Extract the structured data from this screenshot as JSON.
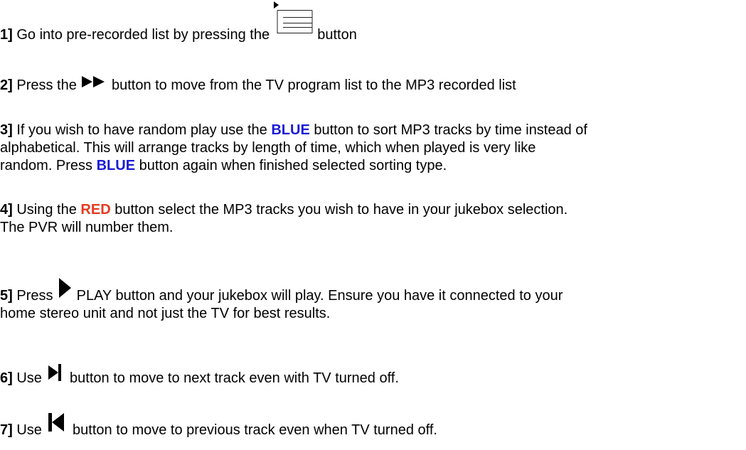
{
  "steps": [
    {
      "num": "1]",
      "before": " Go into pre-recorded list by pressing the ",
      "icon": "list-button-icon",
      "after": " button"
    },
    {
      "num": "2]",
      "before": " Press the ",
      "icon": "fast-forward-icon",
      "after": " button to move from the TV program list to the MP3 recorded list"
    },
    {
      "num": "3]",
      "before": " If you wish to have random play use the ",
      "blue1": "BLUE",
      "mid": " button to sort MP3 tracks by time instead of",
      "line2": "alphabetical. This will arrange tracks by length of time, which when played is very like",
      "line3_before": "random. Press ",
      "blue2": "BLUE",
      "line3_after": " button again when finished selected sorting type."
    },
    {
      "num": "4]",
      "before": " Using the ",
      "red": "RED",
      "after": " button select the MP3 tracks you wish to have in your jukebox selection.",
      "line2": "The PVR will number them."
    },
    {
      "num": "5]",
      "before": " Press ",
      "icon": "play-icon",
      "after": "  PLAY button and your jukebox will play. Ensure you have it connected to your",
      "line2": "home stereo unit and not just the TV for best results."
    },
    {
      "num": "6]",
      "before": " Use ",
      "icon": "next-track-icon",
      "after": " button to move to next track even with TV turned off."
    },
    {
      "num": "7]",
      "before": " Use ",
      "icon": "previous-track-icon",
      "after": " button to move to previous track even when TV turned off."
    }
  ],
  "colors": {
    "blue_label": "#1a1ad6",
    "red_label": "#e53a1e",
    "text": "#000000"
  }
}
